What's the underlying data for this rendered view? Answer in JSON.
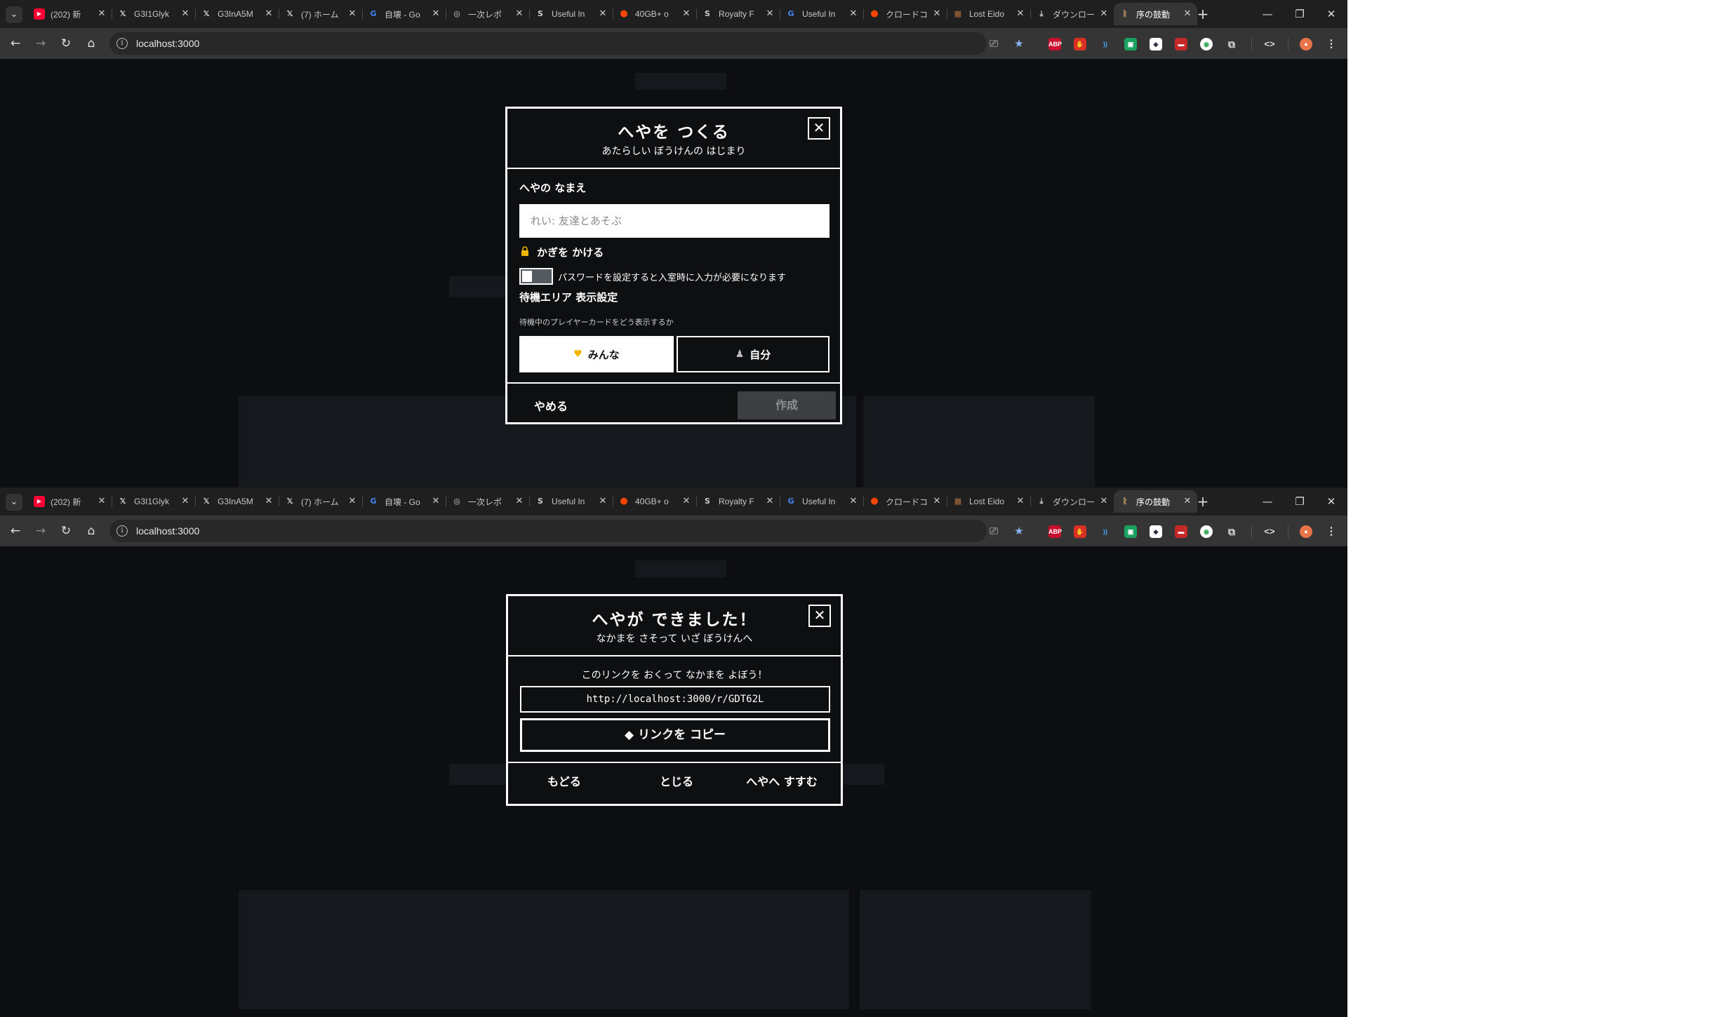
{
  "browser": {
    "tabs": [
      {
        "title": "(202) 新",
        "icon": "youtube-icon",
        "color": "#ff0033"
      },
      {
        "title": "G3I1Glyk",
        "icon": "x-icon",
        "color": "#ffffff"
      },
      {
        "title": "G3InA5M",
        "icon": "x-icon",
        "color": "#ffffff"
      },
      {
        "title": "(7) ホーム",
        "icon": "x-icon",
        "color": "#ffffff"
      },
      {
        "title": "自壊 - Go",
        "icon": "google-icon",
        "color": "#4285f4"
      },
      {
        "title": "一次レポ",
        "icon": "globe-icon",
        "color": "#cccccc"
      },
      {
        "title": "Useful In",
        "icon": "s-icon",
        "color": "#cccccc"
      },
      {
        "title": "40GB+ o",
        "icon": "reddit-icon",
        "color": "#ff4500"
      },
      {
        "title": "Royalty F",
        "icon": "s-icon",
        "color": "#cccccc"
      },
      {
        "title": "Useful In",
        "icon": "google-icon",
        "color": "#4285f4"
      },
      {
        "title": "クロードコ",
        "icon": "reddit-icon",
        "color": "#ff4500"
      },
      {
        "title": "Lost Eido",
        "icon": "game-icon",
        "color": "#b07040"
      },
      {
        "title": "ダウンロー",
        "icon": "download-icon",
        "color": "#cccccc"
      },
      {
        "title": "序の鼓動",
        "icon": "app-icon",
        "color": "#e0b070",
        "active": true
      }
    ],
    "url": "localhost:3000"
  },
  "create_room": {
    "title": "へやを つくる",
    "subtitle": "あたらしい ぼうけんの はじまり",
    "close": "✕",
    "name_label": "へやの なまえ",
    "name_placeholder": "れい: 友達とあそぶ",
    "lock_label": "かぎを かける",
    "password_hint": "パスワードを設定すると入室時に入力が必要になります",
    "waiting_label": "待機エリア 表示設定",
    "waiting_hint": "待機中のプレイヤーカードをどう表示するか",
    "option_everyone": "みんな",
    "option_self": "自分",
    "cancel": "やめる",
    "create": "作成",
    "password_enabled": false,
    "selected_option": "みんな"
  },
  "room_created": {
    "title": "へやが できました！",
    "subtitle": "なかまを さそって いざ ぼうけんへ",
    "close": "✕",
    "instruction": "このリンクを おくって なかまを よぼう！",
    "link": "http://localhost:3000/r/GDT62L",
    "copy": "リンクを コピー",
    "back": "もどる",
    "close_label": "とじる",
    "enter": "へやへ すすむ"
  }
}
